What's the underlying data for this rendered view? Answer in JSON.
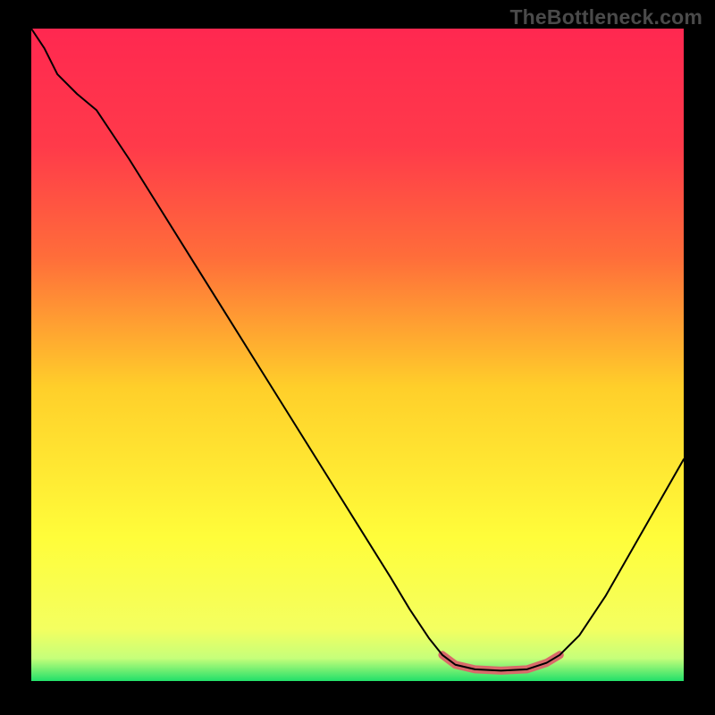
{
  "watermark": "TheBottleneck.com",
  "chart_data": {
    "type": "line",
    "title": "",
    "xlabel": "",
    "ylabel": "",
    "xlim": [
      0,
      100
    ],
    "ylim": [
      0,
      100
    ],
    "background": {
      "type": "vertical-gradient",
      "stops": [
        {
          "offset": 0.0,
          "color": "#ff2850"
        },
        {
          "offset": 0.18,
          "color": "#ff3a4a"
        },
        {
          "offset": 0.35,
          "color": "#ff6d3a"
        },
        {
          "offset": 0.55,
          "color": "#ffcf2a"
        },
        {
          "offset": 0.78,
          "color": "#fffd3a"
        },
        {
          "offset": 0.92,
          "color": "#f4ff60"
        },
        {
          "offset": 0.965,
          "color": "#c6ff7a"
        },
        {
          "offset": 1.0,
          "color": "#22e06a"
        }
      ]
    },
    "series": [
      {
        "name": "curve",
        "color": "#000000",
        "width": 2,
        "points": [
          {
            "x": 0.0,
            "y": 100.0
          },
          {
            "x": 2.0,
            "y": 97.0
          },
          {
            "x": 4.0,
            "y": 93.0
          },
          {
            "x": 7.0,
            "y": 90.0
          },
          {
            "x": 10.0,
            "y": 87.5
          },
          {
            "x": 15.0,
            "y": 80.0
          },
          {
            "x": 20.0,
            "y": 72.0
          },
          {
            "x": 25.0,
            "y": 64.0
          },
          {
            "x": 30.0,
            "y": 56.0
          },
          {
            "x": 35.0,
            "y": 48.0
          },
          {
            "x": 40.0,
            "y": 40.0
          },
          {
            "x": 45.0,
            "y": 32.0
          },
          {
            "x": 50.0,
            "y": 24.0
          },
          {
            "x": 55.0,
            "y": 16.0
          },
          {
            "x": 58.0,
            "y": 11.0
          },
          {
            "x": 61.0,
            "y": 6.5
          },
          {
            "x": 63.0,
            "y": 4.0
          },
          {
            "x": 65.0,
            "y": 2.5
          },
          {
            "x": 68.0,
            "y": 1.8
          },
          {
            "x": 72.0,
            "y": 1.6
          },
          {
            "x": 76.0,
            "y": 1.8
          },
          {
            "x": 79.0,
            "y": 2.8
          },
          {
            "x": 81.0,
            "y": 4.0
          },
          {
            "x": 84.0,
            "y": 7.0
          },
          {
            "x": 88.0,
            "y": 13.0
          },
          {
            "x": 92.0,
            "y": 20.0
          },
          {
            "x": 96.0,
            "y": 27.0
          },
          {
            "x": 100.0,
            "y": 34.0
          }
        ]
      },
      {
        "name": "highlight-band",
        "color": "#d86a6a",
        "width": 9,
        "points": [
          {
            "x": 63.0,
            "y": 4.0
          },
          {
            "x": 65.0,
            "y": 2.5
          },
          {
            "x": 68.0,
            "y": 1.8
          },
          {
            "x": 72.0,
            "y": 1.6
          },
          {
            "x": 76.0,
            "y": 1.8
          },
          {
            "x": 79.0,
            "y": 2.8
          },
          {
            "x": 81.0,
            "y": 4.0
          }
        ]
      }
    ]
  }
}
